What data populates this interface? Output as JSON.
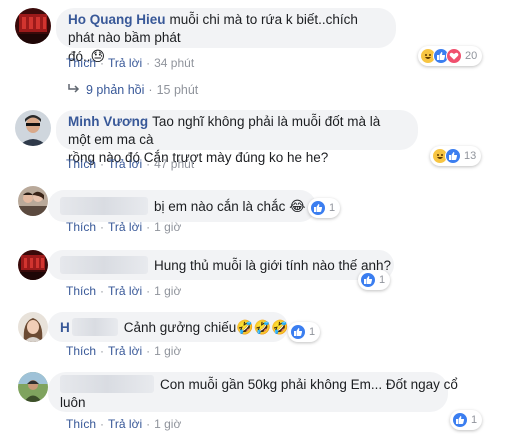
{
  "comments": [
    {
      "author": "Ho Quang Hieu",
      "text_line1": "muỗi chi mà to rứa k biết..chích phát nào bầm phát",
      "text_line2": "đó..",
      "emoji": "😓",
      "reaction_count": "20",
      "time": "34 phút"
    },
    {
      "author": "Minh Vương",
      "text_line1": "Tao nghĩ không phải là muỗi đốt mà là một em ma cà",
      "text_line2": "rồng nào đó Cắn trượt mày đúng ko he he?",
      "reaction_count": "13",
      "time": "47 phút"
    },
    {
      "text": "bị em nào cắn là chắc",
      "emoji": "😂",
      "reaction_count": "1",
      "time": "1 giờ"
    },
    {
      "text": "Hung thủ muỗi là giới tính nào thế anh?",
      "reaction_count": "1",
      "time": "1 giờ"
    },
    {
      "prefix": "H",
      "text": "Cảnh gưởng chiếu",
      "emoji": "🤣🤣🤣",
      "reaction_count": "1",
      "time": "1 giờ"
    },
    {
      "text_line1": "Con muỗi gần 50kg phải không Em... Đốt ngay cổ",
      "text_line2": "luôn",
      "reaction_count": "1",
      "time": "1 giờ"
    }
  ],
  "actions": {
    "like": "Thích",
    "reply": "Trả lời",
    "separator": "·"
  },
  "replies_link": {
    "label": "9 phản hồi",
    "time": "15 phút"
  },
  "colors": {
    "link": "#385898",
    "muted": "#90949c",
    "bubble": "#f2f3f5",
    "like": "#3b7ef0",
    "haha": "#f7c542",
    "love": "#f0506e"
  }
}
